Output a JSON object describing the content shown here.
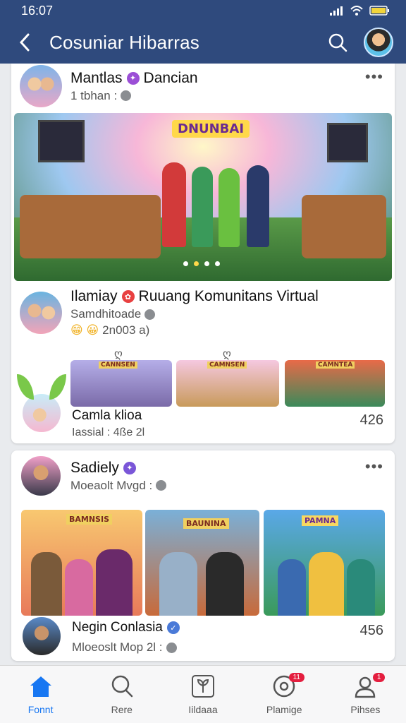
{
  "status": {
    "time": "16:07"
  },
  "header": {
    "title": "Cosuniar Hibarras"
  },
  "posts": [
    {
      "name": "Mantlas",
      "name2": "Dancian",
      "sub": "1 tbhan :",
      "scene_label": "DNUNBAI"
    },
    {
      "name": "Ilamiay",
      "name2": "Ruuang Komunitans Virtual",
      "sub": "Samdhitoade",
      "sub2": "2n003 a)",
      "thumb_labels": [
        "CANNSEN",
        "CAMNSEN",
        "CAMNTEA"
      ],
      "comment_name": "Camla",
      "comment_name2": "klioa",
      "comment_sub": "Iassial : 4ße 2l",
      "count": "426"
    },
    {
      "name": "Sadiely",
      "sub": "Moeaolt Mvgd :",
      "tile_labels": [
        "BAMNSIS",
        "BAUNINA",
        "PAMNA"
      ],
      "comment_name": "Negin Conlasia",
      "comment_sub": "Mloeoslt Mop 2l :",
      "count": "456"
    }
  ],
  "nav": [
    {
      "label": "Fonnt",
      "icon": "home-icon",
      "active": true
    },
    {
      "label": "Rere",
      "icon": "search-people-icon"
    },
    {
      "label": "Iildaaa",
      "icon": "sprout-icon"
    },
    {
      "label": "Plamige",
      "icon": "disc-icon",
      "badge": "11"
    },
    {
      "label": "Pihses",
      "icon": "profile-icon",
      "badge": "1"
    }
  ]
}
